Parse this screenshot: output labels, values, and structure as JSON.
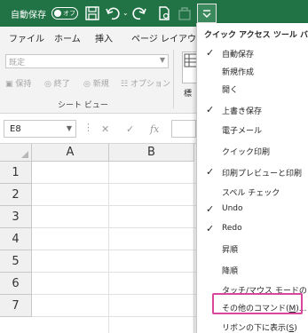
{
  "titlebar": {
    "autosave_label": "自動保存",
    "autosave_state": "オフ",
    "icons": [
      "save-icon",
      "undo-icon",
      "redo-icon",
      "print-preview-icon",
      "quick-access-more-icon"
    ]
  },
  "ribbon_tabs": [
    "ファイル",
    "ホーム",
    "挿入",
    "ページ レイアウト"
  ],
  "ribbon": {
    "sheet_view_dropdown": "既定",
    "buttons": [
      "保持",
      "終了",
      "新規",
      "オプション"
    ],
    "group_label": "シート ビュー",
    "partial_button": "標"
  },
  "formula_bar": {
    "name_box": "E8",
    "fx_label": "fx"
  },
  "grid": {
    "columns": [
      "A",
      "B"
    ],
    "rows": [
      "1",
      "2",
      "3",
      "4",
      "5",
      "6",
      "7"
    ]
  },
  "menu": {
    "title": "クイック アクセス ツール バー",
    "items": [
      {
        "label": "自動保存",
        "checked": true
      },
      {
        "label": "新規作成",
        "checked": false
      },
      {
        "label": "開く",
        "checked": false
      },
      {
        "label": "上書き保存",
        "checked": true
      },
      {
        "label": "電子メール",
        "checked": false
      },
      {
        "label": "クイック印刷",
        "checked": false
      },
      {
        "label": "印刷プレビューと印刷",
        "checked": true
      },
      {
        "label": "スペル チェック",
        "checked": false
      },
      {
        "label": "Undo",
        "checked": true
      },
      {
        "label": "Redo",
        "checked": true
      },
      {
        "label": "昇順",
        "checked": false
      },
      {
        "label": "降順",
        "checked": false
      },
      {
        "label": "タッチ/マウス モードの切",
        "checked": false
      }
    ],
    "more_commands": {
      "before": "その他のコマンド(",
      "key": "M",
      "after": ")..."
    },
    "show_below": {
      "before": "リボンの下に表示(",
      "key": "S",
      "after": ")"
    }
  },
  "colors": {
    "title_bar": "#217346",
    "highlight_border": "#d9469b"
  }
}
